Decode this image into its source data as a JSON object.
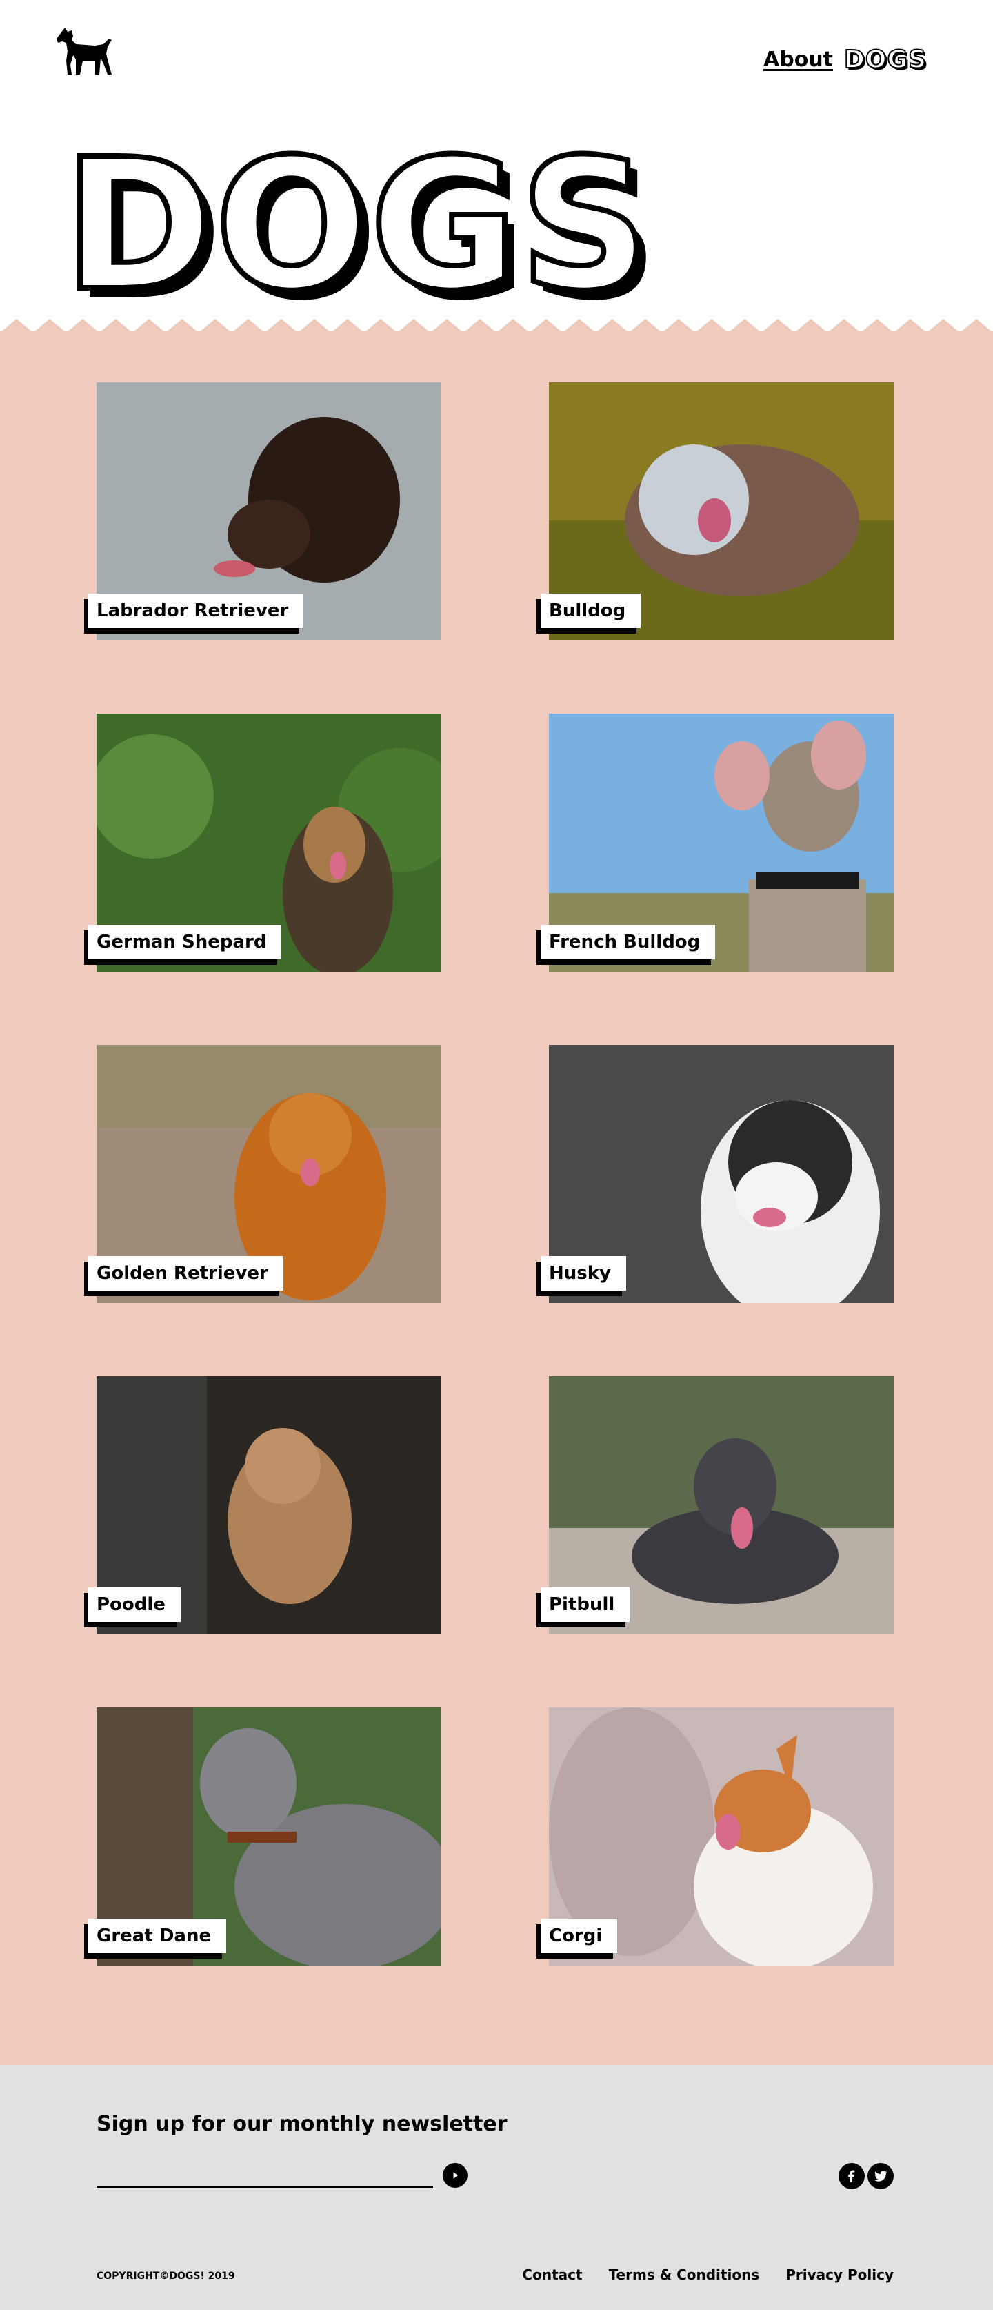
{
  "header": {
    "logo_icon": "dog-silhouette-icon",
    "nav": {
      "about": "About",
      "dogs": "DOGS"
    },
    "hero_title": "DOGS"
  },
  "theme": {
    "gallery_bg": "#f0cabd",
    "footer_bg": "#e1e1e1",
    "accent": "#000000"
  },
  "breeds": [
    {
      "name": "Labrador Retriever"
    },
    {
      "name": "Bulldog"
    },
    {
      "name": "German Shepard"
    },
    {
      "name": "French Bulldog"
    },
    {
      "name": "Golden Retriever"
    },
    {
      "name": "Husky"
    },
    {
      "name": "Poodle"
    },
    {
      "name": "Pitbull"
    },
    {
      "name": "Great Dane"
    },
    {
      "name": "Corgi"
    }
  ],
  "footer": {
    "newsletter_title": "Sign up for our monthly newsletter",
    "email_placeholder": "",
    "submit_icon": "arrow-right-circle-icon",
    "social": [
      "facebook-icon",
      "twitter-icon"
    ],
    "copyright": "COPYRIGHT©DOGS! 2019",
    "links": {
      "contact": "Contact",
      "terms": "Terms & Conditions",
      "privacy": "Privacy Policy"
    }
  }
}
